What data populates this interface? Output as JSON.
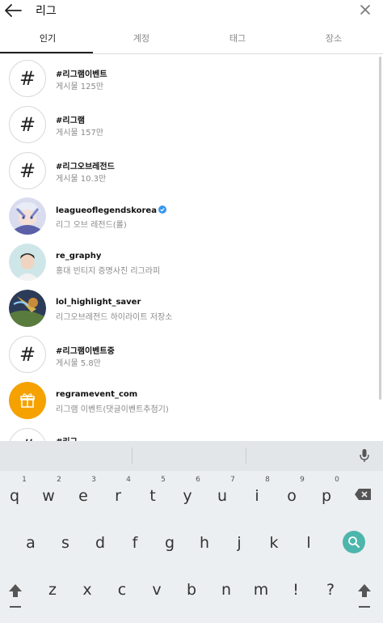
{
  "search": {
    "query": "리그"
  },
  "tabs": [
    {
      "label": "인기"
    },
    {
      "label": "계정"
    },
    {
      "label": "태그"
    },
    {
      "label": "장소"
    }
  ],
  "results": [
    {
      "type": "hashtag",
      "title": "#리그램이벤트",
      "subtitle": "게시물 125만"
    },
    {
      "type": "hashtag",
      "title": "#리그램",
      "subtitle": "게시물 157만"
    },
    {
      "type": "hashtag",
      "title": "#리그오브레전드",
      "subtitle": "게시물 10.3만"
    },
    {
      "type": "account",
      "title": "leagueoflegendskorea",
      "subtitle": "리그 오브 레전드(롤)",
      "verified": true
    },
    {
      "type": "account",
      "title": "re_graphy",
      "subtitle": "홍대 빈티지 증명사진 리그라피"
    },
    {
      "type": "account",
      "title": "lol_highlight_saver",
      "subtitle": "리그오브레전드 하이라이트 저장소"
    },
    {
      "type": "hashtag",
      "title": "#리그램이벤트중",
      "subtitle": "게시물 5.8만"
    },
    {
      "type": "account",
      "title": "regramevent_com",
      "subtitle": "리그램 이벤트(댓글이벤트추첨기)"
    },
    {
      "type": "hashtag",
      "title": "#리그",
      "subtitle": ""
    }
  ],
  "keyboard": {
    "row1": [
      "q",
      "w",
      "e",
      "r",
      "t",
      "y",
      "u",
      "i",
      "o",
      "p"
    ],
    "row1_numbers": [
      "1",
      "2",
      "3",
      "4",
      "5",
      "6",
      "7",
      "8",
      "9",
      "0"
    ],
    "row2": [
      "a",
      "s",
      "d",
      "f",
      "g",
      "h",
      "j",
      "k",
      "l"
    ],
    "row3": [
      "z",
      "x",
      "c",
      "v",
      "b",
      "n",
      "m",
      "!",
      "?"
    ]
  },
  "colors": {
    "accent": "#4db6ac",
    "verified": "#3897f0",
    "event_avatar": "#f5a100"
  }
}
